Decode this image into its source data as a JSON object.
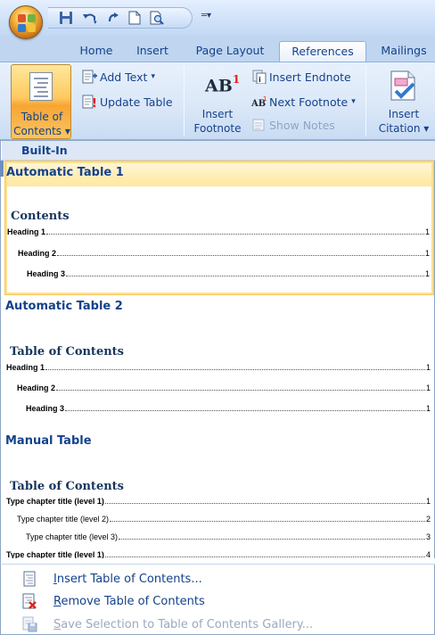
{
  "tabs": [
    "Home",
    "Insert",
    "Page Layout",
    "References",
    "Mailings"
  ],
  "active_tab": "References",
  "ribbon": {
    "toc_button": {
      "line1": "Table of",
      "line2": "Contents",
      "arrow": "▾"
    },
    "add_text": "Add Text",
    "add_text_arrow": "▾",
    "update_table": "Update Table",
    "footnote_icon_text": "AB",
    "footnote_icon_sup": "1",
    "insert_footnote": {
      "line1": "Insert",
      "line2": "Footnote"
    },
    "insert_endnote": "Insert Endnote",
    "next_footnote": "Next Footnote",
    "next_footnote_arrow": "▾",
    "show_notes": "Show Notes",
    "insert_citation": {
      "line1": "Insert",
      "line2": "Citation",
      "arrow": "▾"
    }
  },
  "gallery": {
    "section_title": "Built-In",
    "items": [
      {
        "title": "Automatic Table 1",
        "heading": "Contents",
        "lines": [
          {
            "text": "Heading 1",
            "page": "1",
            "level": 1
          },
          {
            "text": "Heading 2",
            "page": "1",
            "level": 2
          },
          {
            "text": "Heading 3",
            "page": "1",
            "level": 3
          }
        ]
      },
      {
        "title": "Automatic Table 2",
        "heading": "Table of Contents",
        "lines": [
          {
            "text": "Heading 1",
            "page": "1",
            "level": 1
          },
          {
            "text": "Heading 2",
            "page": "1",
            "level": 2
          },
          {
            "text": "Heading 3",
            "page": "1",
            "level": 3
          }
        ]
      },
      {
        "title": "Manual Table",
        "heading": "Table of Contents",
        "lines": [
          {
            "text": "Type chapter title (level 1)",
            "page": "1",
            "level": 1
          },
          {
            "text": "Type chapter title (level 2)",
            "page": "2",
            "level": 2
          },
          {
            "text": "Type chapter title (level 3)",
            "page": "3",
            "level": 3
          },
          {
            "text": "Type chapter title (level 1)",
            "page": "4",
            "level": 1
          }
        ]
      }
    ]
  },
  "menu": {
    "insert_toc": {
      "mnemonic": "I",
      "rest": "nsert Table of Contents..."
    },
    "remove_toc": {
      "mnemonic": "R",
      "rest": "emove Table of Contents"
    },
    "save_selection": {
      "mnemonic": "S",
      "rest": "ave Selection to Table of Contents Gallery..."
    }
  }
}
